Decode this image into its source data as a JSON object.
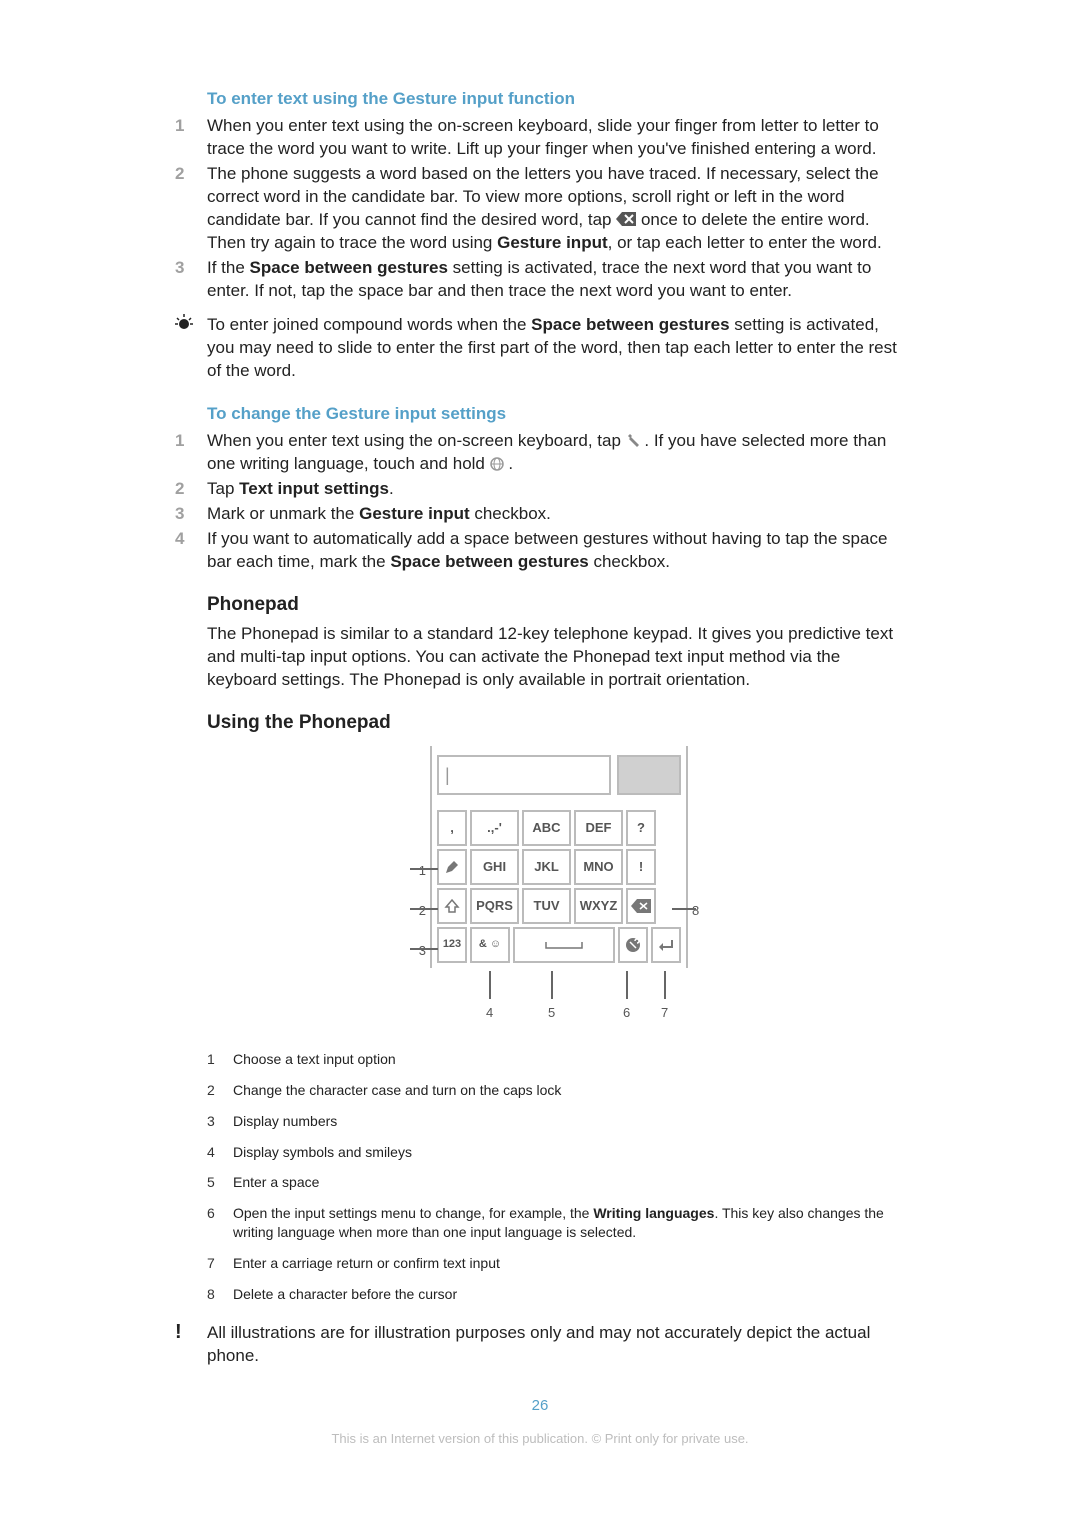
{
  "section1": {
    "title": "To enter text using the Gesture input function",
    "steps": [
      {
        "n": "1",
        "text": "When you enter text using the on-screen keyboard, slide your finger from letter to letter to trace the word you want to write. Lift up your finger when you've finished entering a word."
      },
      {
        "n": "2",
        "pre": "The phone suggests a word based on the letters you have traced. If necessary, select the correct word in the candidate bar. To view more options, scroll right or left in the word candidate bar. If you cannot find the desired word, tap ",
        "post1": " once to delete the entire word. Then try again to trace the word using ",
        "bold1": "Gesture input",
        "post2": ", or tap each letter to enter the word."
      },
      {
        "n": "3",
        "pre": "If the ",
        "bold1": "Space between gestures",
        "post": " setting is activated, trace the next word that you want to enter. If not, tap the space bar and then trace the next word you want to enter."
      }
    ],
    "tip_pre": "To enter joined compound words when the ",
    "tip_bold": "Space between gestures",
    "tip_post": " setting is activated, you may need to slide to enter the first part of the word, then tap each letter to enter the rest of the word."
  },
  "section2": {
    "title": "To change the Gesture input settings",
    "steps": [
      {
        "n": "1",
        "pre": "When you enter text using the on-screen keyboard, tap ",
        "mid": ". If you have selected more than one writing language, touch and hold ",
        "post": "."
      },
      {
        "n": "2",
        "pre": "Tap ",
        "bold": "Text input settings",
        "post": "."
      },
      {
        "n": "3",
        "pre": "Mark or unmark the ",
        "bold": "Gesture input",
        "post": " checkbox."
      },
      {
        "n": "4",
        "pre": "If you want to automatically add a space between gestures without having to tap the space bar each time, mark the ",
        "bold": "Space between gestures",
        "post": " checkbox."
      }
    ]
  },
  "phonepad": {
    "heading": "Phonepad",
    "para": "The Phonepad is similar to a standard 12-key telephone keypad. It gives you predictive text and multi-tap input options. You can activate the Phonepad text input method via the keyboard settings. The Phonepad is only available in portrait orientation."
  },
  "using": {
    "heading": "Using the Phonepad"
  },
  "keypad": {
    "row1": [
      ",",
      ".,-'",
      "ABC",
      "DEF",
      "?"
    ],
    "row2": [
      "",
      "GHI",
      "JKL",
      "MNO",
      "!"
    ],
    "row3": [
      "",
      "PQRS",
      "TUV",
      "WXYZ",
      ""
    ],
    "row4": [
      "123",
      "& ☺",
      "",
      "",
      ""
    ]
  },
  "callouts": {
    "left": {
      "1": "1",
      "2": "2",
      "3": "3"
    },
    "right": {
      "8": "8"
    },
    "bottom": {
      "4": "4",
      "5": "5",
      "6": "6",
      "7": "7"
    }
  },
  "legend": [
    {
      "n": "1",
      "text": "Choose a text input option"
    },
    {
      "n": "2",
      "text": "Change the character case and turn on the caps lock"
    },
    {
      "n": "3",
      "text": "Display numbers"
    },
    {
      "n": "4",
      "text": "Display symbols and smileys"
    },
    {
      "n": "5",
      "text": "Enter a space"
    },
    {
      "n": "6",
      "pre": "Open the input settings menu to change, for example, the ",
      "bold": "Writing languages",
      "post": ". This key also changes the writing language when more than one input language is selected."
    },
    {
      "n": "7",
      "text": "Enter a carriage return or confirm text input"
    },
    {
      "n": "8",
      "text": "Delete a character before the cursor"
    }
  ],
  "warning": "All illustrations are for illustration purposes only and may not accurately depict the actual phone.",
  "page_number": "26",
  "footer": "This is an Internet version of this publication. © Print only for private use."
}
